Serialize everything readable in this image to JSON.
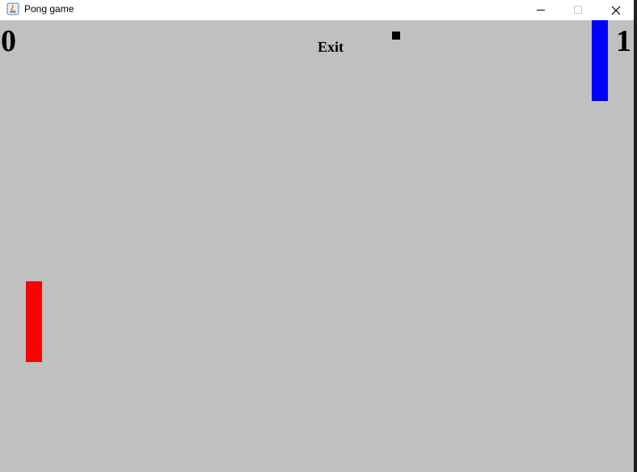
{
  "window": {
    "title": "Pong game",
    "controls": {
      "minimize": "minimize-icon",
      "maximize": "maximize-icon",
      "close": "close-icon"
    }
  },
  "game": {
    "score_left": "0",
    "score_right": "1",
    "exit_label": "Exit",
    "colors": {
      "background": "#c0c0c0",
      "left_paddle": "#ff0000",
      "right_paddle": "#0000ff",
      "ball": "#000000"
    }
  }
}
